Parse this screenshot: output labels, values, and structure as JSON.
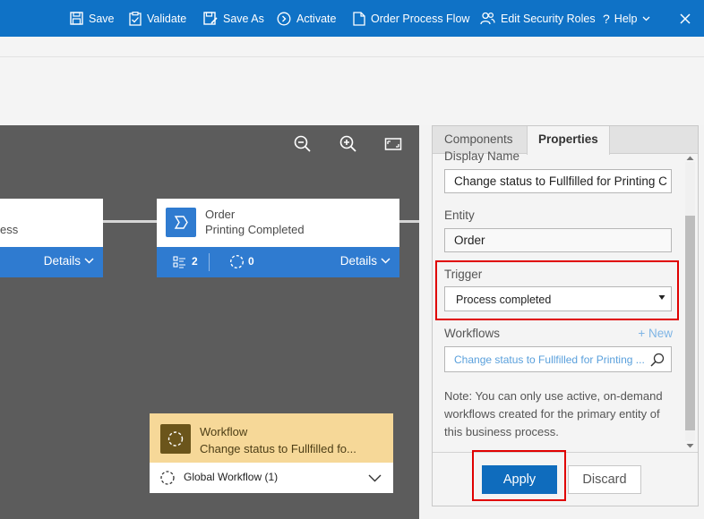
{
  "toolbar": {
    "save": "Save",
    "validate": "Validate",
    "save_as": "Save As",
    "activate": "Activate",
    "order_process_flow": "Order Process Flow",
    "edit_security_roles": "Edit Security Roles",
    "help": "Help"
  },
  "canvas": {
    "left_stage": {
      "subtitle_fragment": "ess",
      "details_label": "Details"
    },
    "order_stage": {
      "title": "Order",
      "subtitle": "Printing Completed",
      "steps_count": "2",
      "workflows_count": "0",
      "details_label": "Details"
    },
    "workflow_card": {
      "title": "Workflow",
      "subtitle": "Change status to Fullfilled fo...",
      "footer_label": "Global Workflow (1)"
    }
  },
  "panel": {
    "tabs": [
      "Components",
      "Properties"
    ],
    "active_tab": "Properties",
    "display_name_label": "Display Name",
    "display_name_value": "Change status to Fullfilled for Printing C",
    "entity_label": "Entity",
    "entity_value": "Order",
    "trigger_label": "Trigger",
    "trigger_value": "Process completed",
    "workflows_label": "Workflows",
    "new_link": "+ New",
    "workflow_lookup_value": "Change status to Fullfilled for Printing ...",
    "note": "Note: You can only use active, on-demand workflows created for the primary entity of this business process.",
    "apply_label": "Apply",
    "discard_label": "Discard"
  },
  "colors": {
    "command_bar": "#0f72c6",
    "canvas_bg": "#5c5c5c",
    "stage_accent": "#2f7bd0",
    "workflow_header": "#f6d898",
    "highlight_red": "#e00000",
    "apply_button": "#0f6cbd"
  }
}
